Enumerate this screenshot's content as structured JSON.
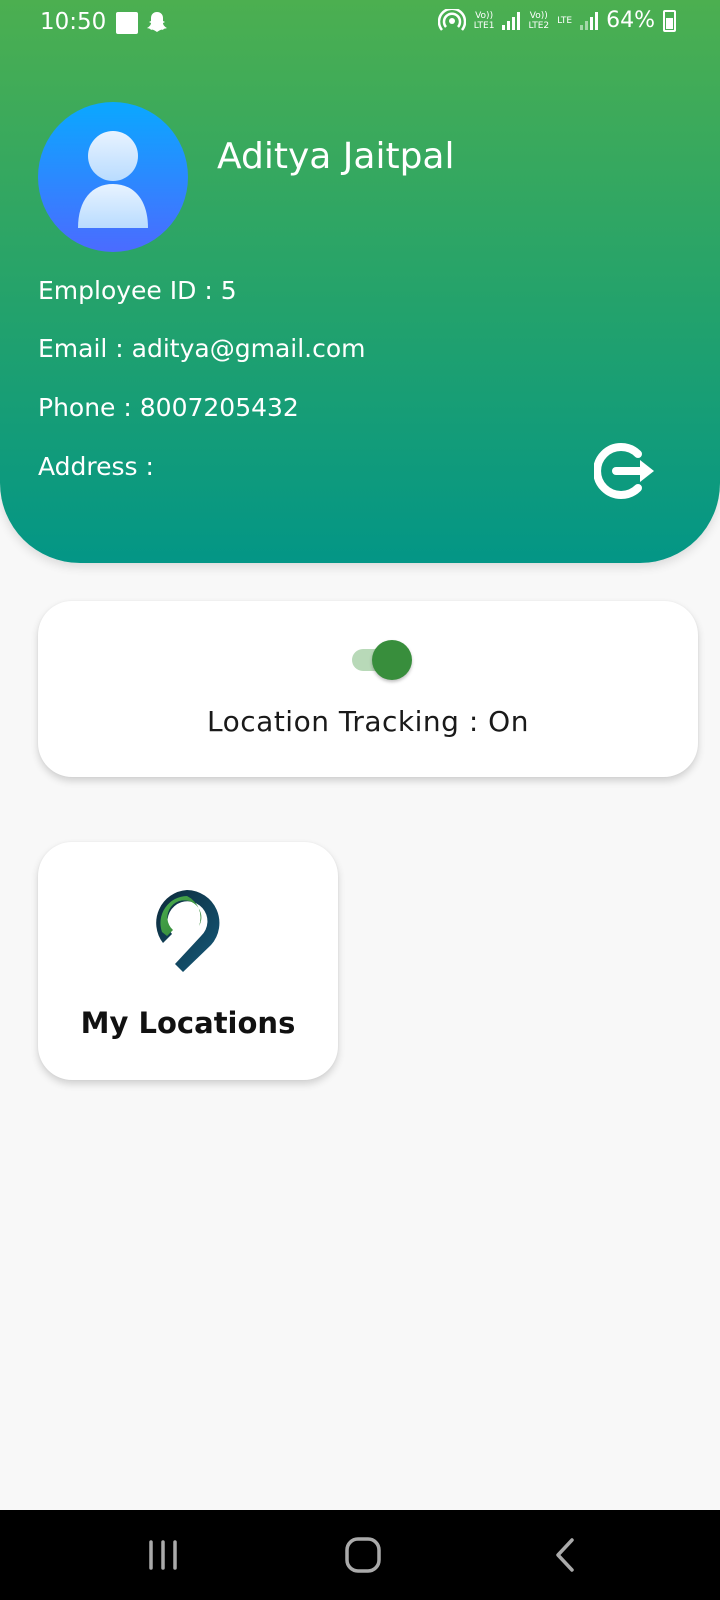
{
  "status_bar": {
    "time": "10:50",
    "sim1_label": "Vo))\nLTE1",
    "sim2_label": "Vo))\nLTE2",
    "lte_label": "LTE",
    "battery": "64%"
  },
  "profile": {
    "name": "Aditya Jaitpal",
    "employee_id": "Employee ID : 5",
    "email": "Email : aditya@gmail.com",
    "phone": "Phone : 8007205432",
    "address": "Address :"
  },
  "tracking": {
    "label": "Location Tracking : On",
    "enabled": true
  },
  "tiles": [
    {
      "label": "My Locations",
      "icon": "location-pin-icon"
    }
  ],
  "colors": {
    "header_top": "#4caf50",
    "header_bottom": "#039686",
    "toggle_thumb": "#388e3c",
    "background": "#f8f8f8"
  },
  "icons": [
    "avatar-icon",
    "logout-icon",
    "location-pin-icon",
    "recent-apps-icon",
    "home-icon",
    "back-icon"
  ]
}
